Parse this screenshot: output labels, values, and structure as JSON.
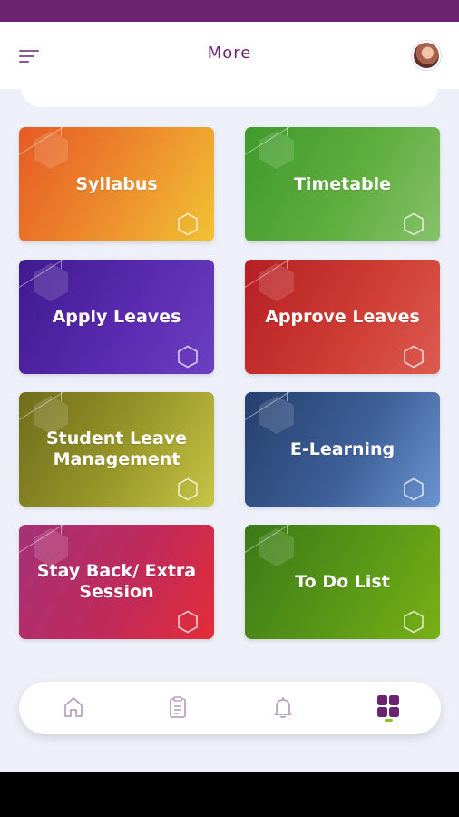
{
  "header": {
    "title": "More",
    "menu_icon": "hamburger-menu-icon",
    "avatar": "user-avatar"
  },
  "cards": [
    {
      "label": "Syllabus",
      "colors": [
        "#e65a24",
        "#f2c233"
      ]
    },
    {
      "label": "Timetable",
      "colors": [
        "#3f9a2c",
        "#86c26a"
      ]
    },
    {
      "label": "Apply Leaves",
      "colors": [
        "#3f1a8f",
        "#6d3fc2"
      ]
    },
    {
      "label": "Approve Leaves",
      "colors": [
        "#b51f26",
        "#dc5b51"
      ]
    },
    {
      "label": "Student Leave Management",
      "colors": [
        "#6f6d1c",
        "#c7c445"
      ]
    },
    {
      "label": "E-Learning",
      "colors": [
        "#26406e",
        "#6a95d0"
      ]
    },
    {
      "label": "Stay Back/ Extra Session",
      "colors": [
        "#a53278",
        "#e42d38"
      ]
    },
    {
      "label": "To Do List",
      "colors": [
        "#3b7a17",
        "#79b015"
      ]
    }
  ],
  "bottom_nav": {
    "items": [
      "home-icon",
      "clipboard-icon",
      "bell-icon",
      "grid-icon"
    ],
    "active": "grid-icon",
    "active_color": "#6b2370",
    "indicator_color": "#8dbf2f"
  },
  "colors": {
    "brand": "#6b2370",
    "background": "#eef0f9"
  }
}
